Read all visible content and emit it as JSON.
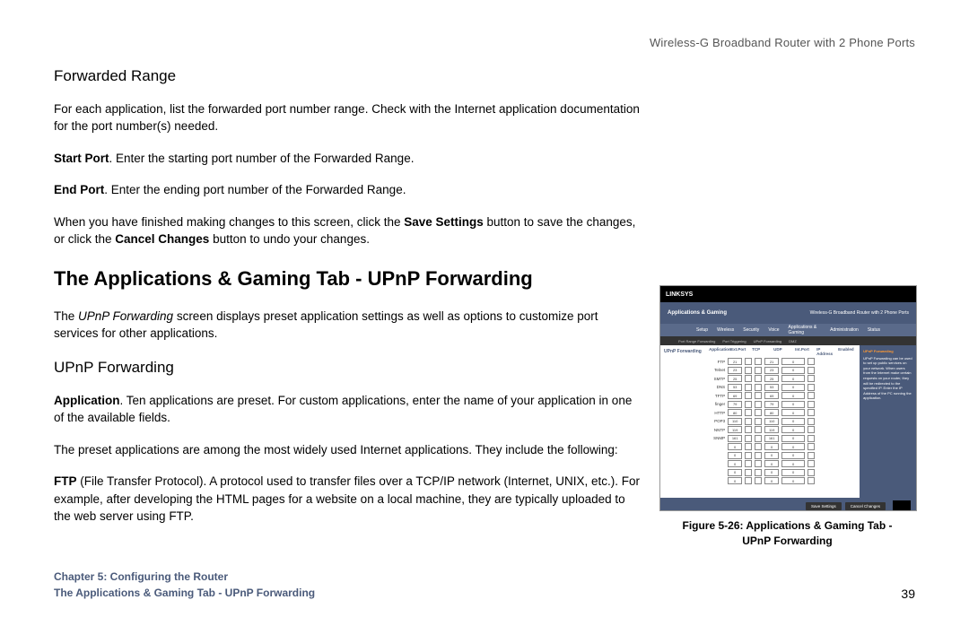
{
  "header": {
    "product": "Wireless-G Broadband Router with 2 Phone Ports"
  },
  "body": {
    "h3_forwarded": "Forwarded Range",
    "p_forwarded": "For each application, list the forwarded port number range. Check with the Internet application documentation for the port number(s) needed.",
    "start_port_b": "Start Port",
    "start_port_t": ". Enter the starting port number of the Forwarded Range.",
    "end_port_b": "End Port",
    "end_port_t": ". Enter the ending port number of the Forwarded Range.",
    "save_pre": "When you have finished making changes to this screen, click the ",
    "save_b": "Save Settings",
    "save_mid": " button to save the changes, or click the ",
    "cancel_b": "Cancel Changes",
    "save_post": " button to undo your changes.",
    "h2_upnp": "The Applications & Gaming Tab - UPnP Forwarding",
    "upnp_pre": "The ",
    "upnp_it": "UPnP Forwarding",
    "upnp_post": " screen displays preset application settings as well as options to customize port services for other applications.",
    "h3_upnp": "UPnP Forwarding",
    "app_b": "Application",
    "app_t": ". Ten applications are preset. For custom applications, enter the name of your application in one of the available fields.",
    "preset_p": "The preset applications are among the most widely used Internet applications. They include the following:",
    "ftp_b": "FTP",
    "ftp_t": " (File Transfer Protocol). A protocol used to transfer files over a TCP/IP network (Internet, UNIX, etc.). For example, after developing the HTML pages for a website on a local machine, they are typically uploaded to the web server using FTP."
  },
  "figure": {
    "brand": "LINKSYS",
    "leftnav": "Applications & Gaming",
    "title_right": "Wireless-G Broadband Router with 2 Phone Ports",
    "tabs": [
      "Setup",
      "Wireless",
      "Security",
      "Voice",
      "Applications & Gaming",
      "Administration",
      "Status"
    ],
    "subtabs": [
      "Port Range Forwarding",
      "Port Triggering",
      "UPnP Forwarding",
      "DMZ"
    ],
    "panel_label": "UPnP Forwarding",
    "cols": [
      "Application",
      "Ext.Port",
      "TCP",
      "UDP",
      "Int.Port",
      "IP Address",
      "Enabled"
    ],
    "rows": [
      {
        "app": "FTP",
        "ext": "21",
        "tcp": "x",
        "udp": "",
        "int": "21",
        "ip": "0"
      },
      {
        "app": "Telnet",
        "ext": "23",
        "tcp": "x",
        "udp": "",
        "int": "23",
        "ip": "0"
      },
      {
        "app": "SMTP",
        "ext": "25",
        "tcp": "x",
        "udp": "",
        "int": "25",
        "ip": "0"
      },
      {
        "app": "DNS",
        "ext": "53",
        "tcp": "",
        "udp": "x",
        "int": "53",
        "ip": "0"
      },
      {
        "app": "TFTP",
        "ext": "69",
        "tcp": "",
        "udp": "x",
        "int": "69",
        "ip": "0"
      },
      {
        "app": "finger",
        "ext": "79",
        "tcp": "x",
        "udp": "",
        "int": "79",
        "ip": "0"
      },
      {
        "app": "HTTP",
        "ext": "80",
        "tcp": "x",
        "udp": "",
        "int": "80",
        "ip": "0"
      },
      {
        "app": "POP3",
        "ext": "110",
        "tcp": "x",
        "udp": "",
        "int": "110",
        "ip": "0"
      },
      {
        "app": "NNTP",
        "ext": "119",
        "tcp": "x",
        "udp": "",
        "int": "119",
        "ip": "0"
      },
      {
        "app": "SNMP",
        "ext": "161",
        "tcp": "",
        "udp": "x",
        "int": "161",
        "ip": "0"
      },
      {
        "app": "",
        "ext": "0",
        "tcp": "",
        "udp": "",
        "int": "0",
        "ip": "0"
      },
      {
        "app": "",
        "ext": "0",
        "tcp": "",
        "udp": "",
        "int": "0",
        "ip": "0"
      },
      {
        "app": "",
        "ext": "0",
        "tcp": "",
        "udp": "",
        "int": "0",
        "ip": "0"
      },
      {
        "app": "",
        "ext": "0",
        "tcp": "",
        "udp": "",
        "int": "0",
        "ip": "0"
      },
      {
        "app": "",
        "ext": "0",
        "tcp": "",
        "udp": "",
        "int": "0",
        "ip": "0"
      }
    ],
    "side_title": "UPnP Forwarding",
    "side_text": "UPnP Forwarding can be used to set up public services on your network. When users from the Internet make certain requests on your router, they will be redirected to the specified IP. Enter the IP Address of the PC running the application.",
    "btn_save": "Save Settings",
    "btn_cancel": "Cancel Changes",
    "caption_l1": "Figure 5-26: Applications & Gaming Tab -",
    "caption_l2": "UPnP Forwarding"
  },
  "footer": {
    "chapter": "Chapter 5: Configuring the Router",
    "section": "The Applications & Gaming Tab - UPnP Forwarding",
    "page": "39"
  }
}
